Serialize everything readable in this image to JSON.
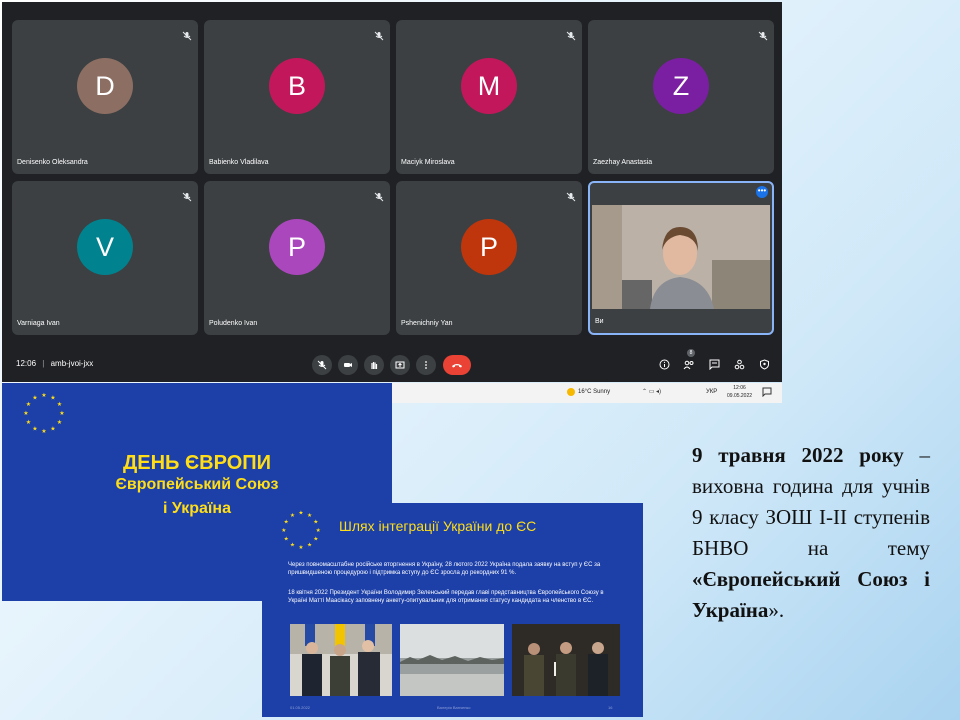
{
  "meet": {
    "participants": [
      {
        "initial": "D",
        "name": "Denisenko Oleksandra",
        "color": "#8d6e63"
      },
      {
        "initial": "B",
        "name": "Babienko Vladilava",
        "color": "#c2185b"
      },
      {
        "initial": "M",
        "name": "Maciyk Miroslava",
        "color": "#c2185b"
      },
      {
        "initial": "Z",
        "name": "Zaezhay Anastasia",
        "color": "#7b1fa2"
      },
      {
        "initial": "V",
        "name": "Varniaga Ivan",
        "color": "#00838f"
      },
      {
        "initial": "P",
        "name": "Poludenko Ivan",
        "color": "#ab47bc"
      },
      {
        "initial": "P",
        "name": "Pshenichniy Yan",
        "color": "#bf360c"
      }
    ],
    "self_label": "Ви",
    "time": "12:06",
    "meeting_code": "amb-jvoi-jxx",
    "participant_count": "8",
    "end_color": "#ea4335"
  },
  "taskbar": {
    "weather": "16°C  Sunny",
    "lang": "УКР",
    "clock_time": "12:06",
    "clock_date": "09.05.2022"
  },
  "slide1": {
    "line1": "ДЕНЬ ЄВРОПИ",
    "line2": "Європейський Союз",
    "line3": "і Україна"
  },
  "slide2": {
    "title": "Шлях інтеграції України до ЄС",
    "para1": "Через повномасштабне російське вторгнення в Україну, 28 лютого 2022 Україна подала заявку на вступ у ЄС за пришвидшеною процедурою і підтримка вступу до ЄС зросла до рекордних 91 %.",
    "para2": "18 квітня 2022 Президент України Володимир Зеленський передав главі представництва Європейського Союзу в Україні Матті Маасікасу заповнену анкету-опитувальник для отримання статусу кандидата на членство в ЄС.",
    "footer_date": "01.05.2022",
    "footer_center": "Валерія Ванченко",
    "footer_page": "16"
  },
  "description": {
    "date": "9 травня 2022 року",
    "text": " – виховна година для учнів 9 класу ЗОШ І-ІІ ступенів БНВО на тему ",
    "topic": "«Європейський Союз і Україна",
    "end": "»."
  }
}
